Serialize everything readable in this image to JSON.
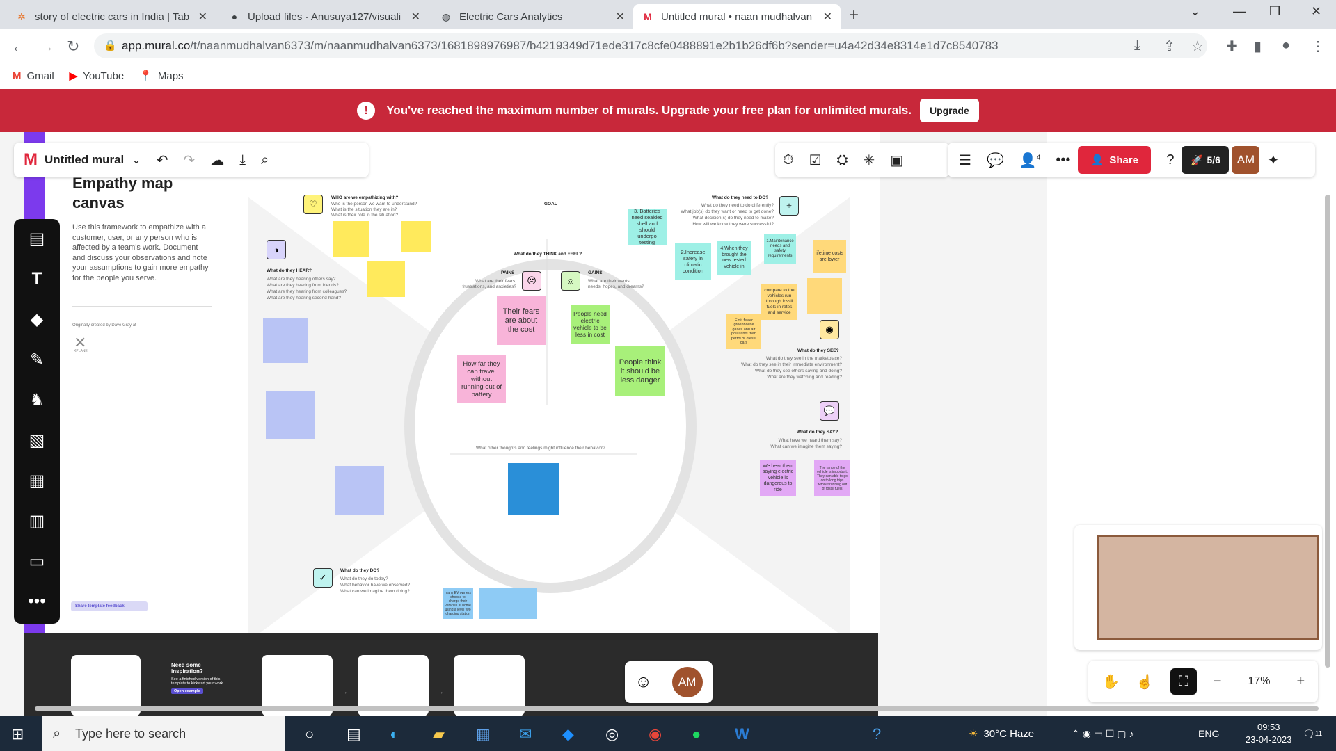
{
  "browser": {
    "tabs": [
      {
        "title": "story of electric cars in India | Tab",
        "icon": "tableau-icon"
      },
      {
        "title": "Upload files · Anusuya127/visuali",
        "icon": "github-icon"
      },
      {
        "title": "Electric Cars Analytics",
        "icon": "globe-icon"
      },
      {
        "title": "Untitled mural • naan mudhalvan",
        "icon": "mural-icon"
      }
    ],
    "url_host": "app.mural.co",
    "url_path": "/t/naanmudhalvan6373/m/naanmudhalvan6373/1681898976987/b4219349d71ede317c8cfe0488891e2b1b26df6b?sender=u4a42d34e8314e1d7c8540783",
    "bookmarks": [
      {
        "label": "Gmail",
        "icon": "gmail-icon",
        "color": "#ea4335"
      },
      {
        "label": "YouTube",
        "icon": "youtube-icon",
        "color": "#ff0000"
      },
      {
        "label": "Maps",
        "icon": "maps-icon",
        "color": "#34a853"
      }
    ]
  },
  "banner": {
    "message": "You've reached the maximum number of murals. Upgrade your free plan for unlimited murals.",
    "button": "Upgrade",
    "color": "#c8283a"
  },
  "toolbar": {
    "mural_title": "Untitled mural",
    "share_label": "Share",
    "launch_label": "5/6",
    "avatar": "AM",
    "members_count": "4"
  },
  "template": {
    "title": "Empathy map canvas",
    "description": "Use this framework to empathize with a customer, user, or any person who is affected by a team's work. Document and discuss your observations and note your assumptions to gain more empathy for the people you serve.",
    "credit": "Originally created by Dave Gray at",
    "credit_brand": "XPLANE",
    "feedback": "Share template feedback",
    "inspiration_title": "Need some inspiration?",
    "inspiration_text": "See a finished version of this template to kickstart your work.",
    "inspiration_button": "Open example"
  },
  "board": {
    "who": {
      "title": "WHO are we empathizing with?",
      "lines": [
        "Who is the person we want to understand?",
        "What is the situation they are in?",
        "What is their role in the situation?"
      ]
    },
    "goal": "GOAL",
    "need_to_do": {
      "title": "What do they need to DO?",
      "lines": [
        "What do they need to do differently?",
        "What job(s) do they want or need to get done?",
        "What decision(s) do they need to make?",
        "How will we know they were successful?"
      ]
    },
    "think_feel": "What do they THINK and FEEL?",
    "pains": {
      "title": "PAINS",
      "lines": [
        "What are their fears,",
        "frustrations, and anxieties?"
      ]
    },
    "gains": {
      "title": "GAINS",
      "lines": [
        "What are their wants,",
        "needs, hopes, and dreams?"
      ]
    },
    "hear": {
      "title": "What do they HEAR?",
      "lines": [
        "What are they hearing others say?",
        "What are they hearing from friends?",
        "What are they hearing from colleagues?",
        "What are they hearing second-hand?"
      ]
    },
    "see": {
      "title": "What do they SEE?",
      "lines": [
        "What do they see in the marketplace?",
        "What do they see in their immediate environment?",
        "What do they see others saying and doing?",
        "What are they watching and reading?"
      ]
    },
    "say": {
      "title": "What do they SAY?",
      "lines": [
        "What have we heard them say?",
        "What can we imagine them saying?"
      ]
    },
    "do": {
      "title": "What do they DO?",
      "lines": [
        "What do they do today?",
        "What behavior have we observed?",
        "What can we imagine them doing?"
      ]
    },
    "other_thoughts": "What other thoughts and feelings might influence their behavior?",
    "stickies": [
      {
        "text": "3. Batteries need sealded shell and should undergo testing",
        "color": "#9ef0e6"
      },
      {
        "text": "2.Increase safety in climatic condition",
        "color": "#9ef0e6"
      },
      {
        "text": "4.When they brought the new tested vehicle in",
        "color": "#9ef0e6"
      },
      {
        "text": "1.Maintenance needs and safety requirements",
        "color": "#9ef0e6"
      },
      {
        "text": "lifetime costs are lower",
        "color": "#ffd97a"
      },
      {
        "text": "compare to the vehicles run through fossil fuels in rates and service",
        "color": "#ffd97a"
      },
      {
        "text": "Emit fewer greenhouse gases and air pollutants than petrol or diesel cars",
        "color": "#ffd97a"
      },
      {
        "text": "Their fears are about the cost",
        "color": "#f8b4d9"
      },
      {
        "text": "How far they can travel without running out of battery",
        "color": "#f8b4d9"
      },
      {
        "text": "People need electric vehicle to be less in cost",
        "color": "#a8f07a"
      },
      {
        "text": "People think it should be less danger",
        "color": "#a8f07a"
      },
      {
        "text": "We hear them saying electric vehicle is dangerous to ride",
        "color": "#e2a8f5"
      },
      {
        "text": "The range of the vehicle is important. They can able to go on to long trips without running out of fossil fuels",
        "color": "#e2a8f5"
      },
      {
        "text": "many EV owners choose to charge their vehicles at home using a level two charging station",
        "color": "#8ecbf5"
      }
    ]
  },
  "zoom": "17%",
  "taskbar": {
    "search_placeholder": "Type here to search",
    "weather": "30°C  Haze",
    "lang": "ENG",
    "time": "09:53",
    "date": "23-04-2023",
    "notif_count": "11"
  }
}
